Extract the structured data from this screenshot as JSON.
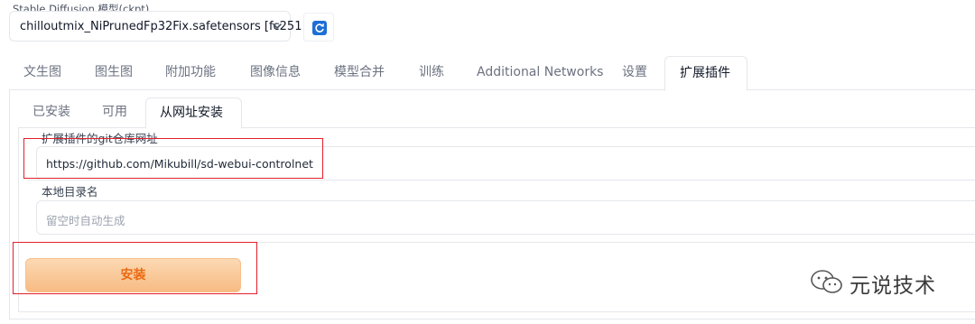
{
  "model_section": {
    "label": "Stable Diffusion 模型(ckpt)",
    "selected_model": "chilloutmix_NiPrunedFp32Fix.safetensors [fc251",
    "accent": "#1d6fd6"
  },
  "tabs": [
    {
      "label": "文生图"
    },
    {
      "label": "图生图"
    },
    {
      "label": "附加功能"
    },
    {
      "label": "图像信息"
    },
    {
      "label": "模型合并"
    },
    {
      "label": "训练"
    },
    {
      "label": "Additional Networks"
    },
    {
      "label": "设置"
    },
    {
      "label": "扩展插件",
      "active": true
    }
  ],
  "subtabs": [
    {
      "label": "已安装"
    },
    {
      "label": "可用"
    },
    {
      "label": "从网址安装",
      "active": true
    }
  ],
  "install_form": {
    "repo_label": "扩展插件的git仓库网址",
    "repo_value": "https://github.com/Mikubill/sd-webui-controlnet",
    "dir_label": "本地目录名",
    "dir_placeholder": "留空时自动生成",
    "install_button": "安装"
  },
  "watermark": {
    "text": "元说技术"
  },
  "colors": {
    "install_button_text": "#ea6a12",
    "highlight_box": "#e3202a"
  }
}
